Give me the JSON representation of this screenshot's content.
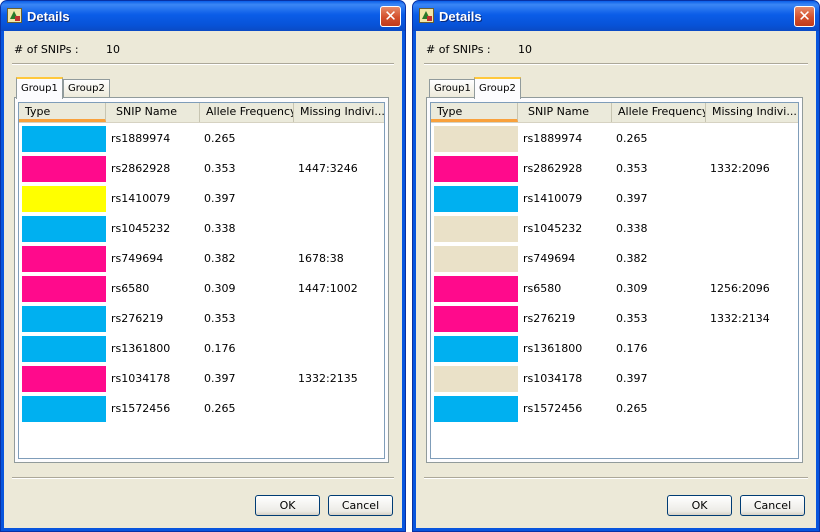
{
  "windows": [
    {
      "title": "Details",
      "snip_count_label": "# of SNIPs :",
      "snip_count_value": "10",
      "tabs": [
        "Group1",
        "Group2"
      ],
      "active_tab": 0,
      "columns": [
        "Type",
        "SNIP Name",
        "Allele Frequency",
        "Missing Indivi..."
      ],
      "rows": [
        {
          "color": "#00b0f0",
          "snip": "rs1889974",
          "freq": "0.265",
          "missing": ""
        },
        {
          "color": "#ff0a8c",
          "snip": "rs2862928",
          "freq": "0.353",
          "missing": "1447:3246"
        },
        {
          "color": "#ffff00",
          "snip": "rs1410079",
          "freq": "0.397",
          "missing": ""
        },
        {
          "color": "#00b0f0",
          "snip": "rs1045232",
          "freq": "0.338",
          "missing": ""
        },
        {
          "color": "#ff0a8c",
          "snip": "rs749694",
          "freq": "0.382",
          "missing": "1678:38"
        },
        {
          "color": "#ff0a8c",
          "snip": "rs6580",
          "freq": "0.309",
          "missing": "1447:1002"
        },
        {
          "color": "#00b0f0",
          "snip": "rs276219",
          "freq": "0.353",
          "missing": ""
        },
        {
          "color": "#00b0f0",
          "snip": "rs1361800",
          "freq": "0.176",
          "missing": ""
        },
        {
          "color": "#ff0a8c",
          "snip": "rs1034178",
          "freq": "0.397",
          "missing": "1332:2135"
        },
        {
          "color": "#00b0f0",
          "snip": "rs1572456",
          "freq": "0.265",
          "missing": ""
        }
      ],
      "ok_label": "OK",
      "cancel_label": "Cancel"
    },
    {
      "title": "Details",
      "snip_count_label": "# of SNIPs :",
      "snip_count_value": "10",
      "tabs": [
        "Group1",
        "Group2"
      ],
      "active_tab": 1,
      "columns": [
        "Type",
        "SNIP Name",
        "Allele Frequency",
        "Missing Indivi..."
      ],
      "rows": [
        {
          "color": "#eae1c8",
          "snip": "rs1889974",
          "freq": "0.265",
          "missing": ""
        },
        {
          "color": "#ff0a8c",
          "snip": "rs2862928",
          "freq": "0.353",
          "missing": "1332:2096"
        },
        {
          "color": "#00b0f0",
          "snip": "rs1410079",
          "freq": "0.397",
          "missing": ""
        },
        {
          "color": "#eae1c8",
          "snip": "rs1045232",
          "freq": "0.338",
          "missing": ""
        },
        {
          "color": "#eae1c8",
          "snip": "rs749694",
          "freq": "0.382",
          "missing": ""
        },
        {
          "color": "#ff0a8c",
          "snip": "rs6580",
          "freq": "0.309",
          "missing": "1256:2096"
        },
        {
          "color": "#ff0a8c",
          "snip": "rs276219",
          "freq": "0.353",
          "missing": "1332:2134"
        },
        {
          "color": "#00b0f0",
          "snip": "rs1361800",
          "freq": "0.176",
          "missing": ""
        },
        {
          "color": "#eae1c8",
          "snip": "rs1034178",
          "freq": "0.397",
          "missing": ""
        },
        {
          "color": "#00b0f0",
          "snip": "rs1572456",
          "freq": "0.265",
          "missing": ""
        }
      ],
      "ok_label": "OK",
      "cancel_label": "Cancel"
    }
  ]
}
